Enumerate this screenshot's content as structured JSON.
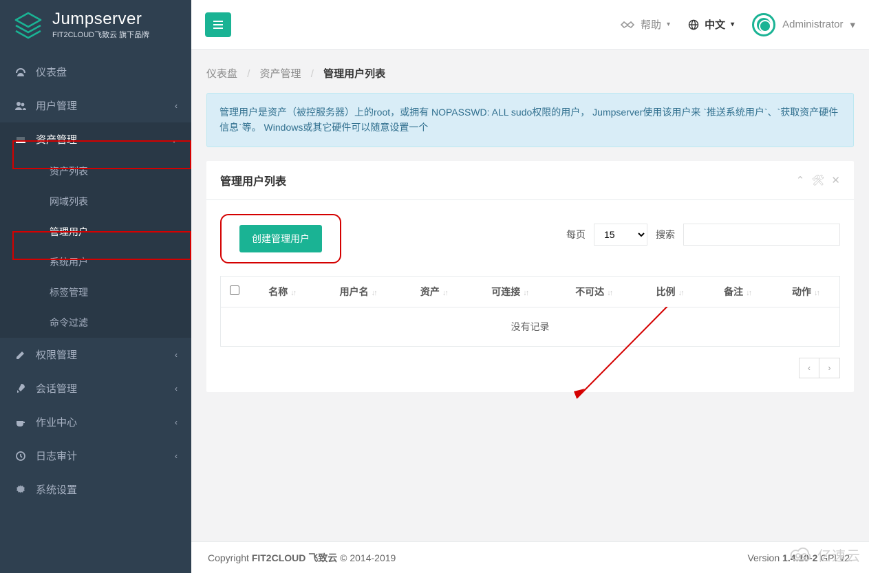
{
  "brand": {
    "title": "Jumpserver",
    "subtitle": "FIT2CLOUD飞致云 旗下品牌"
  },
  "topbar": {
    "help": "帮助",
    "language": "中文",
    "user": "Administrator"
  },
  "sidebar": {
    "items": [
      {
        "label": "仪表盘"
      },
      {
        "label": "用户管理"
      },
      {
        "label": "资产管理"
      },
      {
        "label": "权限管理"
      },
      {
        "label": "会话管理"
      },
      {
        "label": "作业中心"
      },
      {
        "label": "日志审计"
      },
      {
        "label": "系统设置"
      }
    ],
    "assetsSubmenu": [
      {
        "label": "资产列表"
      },
      {
        "label": "网域列表"
      },
      {
        "label": "管理用户"
      },
      {
        "label": "系统用户"
      },
      {
        "label": "标签管理"
      },
      {
        "label": "命令过滤"
      }
    ]
  },
  "breadcrumb": {
    "a": "仪表盘",
    "b": "资产管理",
    "c": "管理用户列表"
  },
  "alert": "管理用户是资产（被控服务器）上的root，或拥有 NOPASSWD: ALL sudo权限的用户， Jumpserver使用该用户来 `推送系统用户`、`获取资产硬件信息`等。 Windows或其它硬件可以随意设置一个",
  "panel": {
    "title": "管理用户列表",
    "create_button": "创建管理用户",
    "per_page_label": "每页",
    "per_page_value": "15",
    "search_label": "搜索",
    "search_value": "",
    "columns": [
      "名称",
      "用户名",
      "资产",
      "可连接",
      "不可达",
      "比例",
      "备注",
      "动作"
    ],
    "empty": "没有记录"
  },
  "footer": {
    "copyright_prefix": "Copyright ",
    "copyright_bold": "FIT2CLOUD 飞致云",
    "copyright_suffix": " © 2014-2019",
    "version_prefix": "Version ",
    "version_bold": "1.4.10-2",
    "version_suffix": " GPLv2."
  },
  "watermark": "亿速云"
}
